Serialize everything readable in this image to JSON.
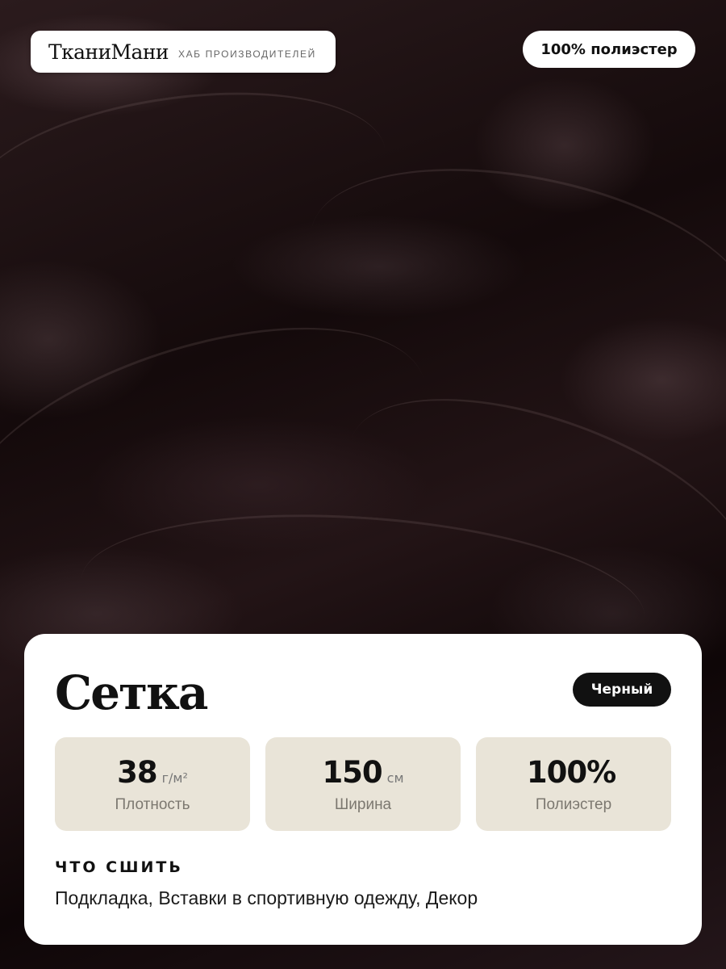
{
  "brand": {
    "name": "ТканиМани",
    "subtitle": "ХАБ ПРОИЗВОДИТЕЛЕЙ"
  },
  "composition_badge": "100% полиэстер",
  "product": {
    "title": "Сетка",
    "color": "Черный"
  },
  "stats": [
    {
      "value": "38",
      "unit": "г/м²",
      "label": "Плотность"
    },
    {
      "value": "150",
      "unit": "см",
      "label": "Ширина"
    },
    {
      "value": "100%",
      "unit": "",
      "label": "Полиэстер"
    }
  ],
  "uses": {
    "heading": "ЧТО СШИТЬ",
    "text": "Подкладка, Вставки в спортивную одежду, Декор"
  }
}
